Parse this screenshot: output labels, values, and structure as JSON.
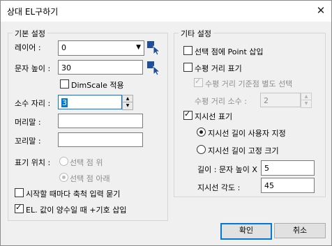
{
  "window": {
    "title": "상대 EL구하기",
    "close_glyph": "✕"
  },
  "left_group": {
    "title": "기본 설정",
    "layer_label": "레이어 :",
    "layer_value": "0",
    "text_height_label": "문자 높이 :",
    "text_height_value": "30",
    "dimscale_label": "DimScale 적용",
    "dimscale_checked": false,
    "decimal_label": "소수 자리 :",
    "decimal_value": "3",
    "prefix_label": "머리말 :",
    "prefix_value": "",
    "suffix_label": "꼬리말 :",
    "suffix_value": "",
    "position_label": "표기 위치 :",
    "position_above": "선택 점 위",
    "position_below": "선택 점 아래",
    "position_selected": "below",
    "ask_scale_label": "시작할 때마다 축척 입력 묻기",
    "ask_scale_checked": false,
    "plus_sign_label": "EL. 값이 양수일 때 +기호 삽입",
    "plus_sign_checked": true
  },
  "right_group": {
    "title": "기타 설정",
    "insert_point_label": "선택 점에 Point 삽입",
    "insert_point_checked": false,
    "horiz_dist_label": "수평 거리 표기",
    "horiz_dist_checked": false,
    "base_point_label": "수평 거리 기준점 별도 선택",
    "base_point_checked": true,
    "horiz_decimal_label": "수평 거리 소수 :",
    "horiz_decimal_value": "2",
    "leader_label": "지시선 표기",
    "leader_checked": true,
    "leader_user_label": "지시선 길이 사용자 지정",
    "leader_fixed_label": "지시선 길이 고정 크기",
    "leader_mode": "user",
    "length_label": "길이 : 문자 높이 X",
    "length_value": "5",
    "angle_label": "지시선 각도 :",
    "angle_value": "45"
  },
  "buttons": {
    "ok": "확인",
    "cancel": "취소"
  },
  "colors": {
    "accent": "#0078d7",
    "pick_icon": "#1f4e9a"
  },
  "icons": [
    "chevron-down-icon",
    "pick-cursor-icon",
    "spin-up-icon",
    "spin-down-icon",
    "close-icon"
  ]
}
